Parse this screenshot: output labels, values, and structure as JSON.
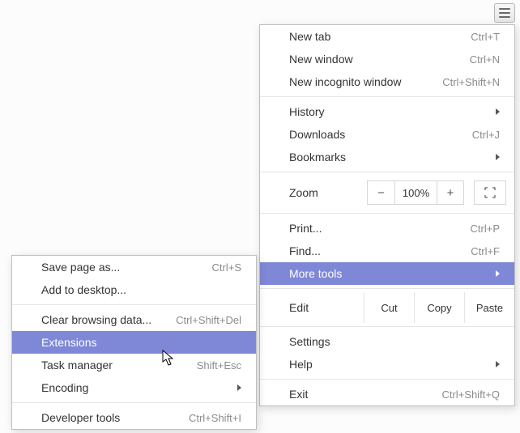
{
  "hamburger": {
    "name": "main-menu"
  },
  "main_menu": {
    "new_tab": {
      "label": "New tab",
      "shortcut": "Ctrl+T"
    },
    "new_window": {
      "label": "New window",
      "shortcut": "Ctrl+N"
    },
    "incognito": {
      "label": "New incognito window",
      "shortcut": "Ctrl+Shift+N"
    },
    "history": {
      "label": "History"
    },
    "downloads": {
      "label": "Downloads",
      "shortcut": "Ctrl+J"
    },
    "bookmarks": {
      "label": "Bookmarks"
    },
    "zoom": {
      "label": "Zoom",
      "minus": "−",
      "value": "100%",
      "plus": "+"
    },
    "print": {
      "label": "Print...",
      "shortcut": "Ctrl+P"
    },
    "find": {
      "label": "Find...",
      "shortcut": "Ctrl+F"
    },
    "more_tools": {
      "label": "More tools"
    },
    "edit": {
      "label": "Edit",
      "cut": "Cut",
      "copy": "Copy",
      "paste": "Paste"
    },
    "settings": {
      "label": "Settings"
    },
    "help": {
      "label": "Help"
    },
    "exit": {
      "label": "Exit",
      "shortcut": "Ctrl+Shift+Q"
    }
  },
  "sub_menu": {
    "save_page": {
      "label": "Save page as...",
      "shortcut": "Ctrl+S"
    },
    "add_desktop": {
      "label": "Add to desktop..."
    },
    "clear_data": {
      "label": "Clear browsing data...",
      "shortcut": "Ctrl+Shift+Del"
    },
    "extensions": {
      "label": "Extensions"
    },
    "task_manager": {
      "label": "Task manager",
      "shortcut": "Shift+Esc"
    },
    "encoding": {
      "label": "Encoding"
    },
    "dev_tools": {
      "label": "Developer tools",
      "shortcut": "Ctrl+Shift+I"
    }
  }
}
